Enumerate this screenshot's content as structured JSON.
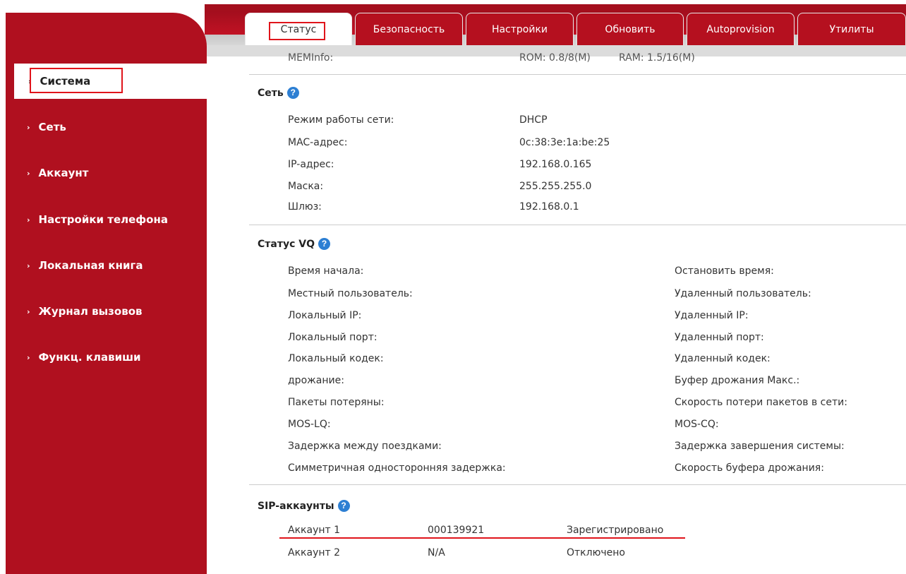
{
  "tabs": [
    {
      "label": "Статус",
      "active": true
    },
    {
      "label": "Безопасность"
    },
    {
      "label": "Настройки"
    },
    {
      "label": "Обновить"
    },
    {
      "label": "Autoprovision"
    },
    {
      "label": "Утилиты"
    }
  ],
  "sidebar": {
    "items": [
      {
        "label": "Система",
        "active": true
      },
      {
        "label": "Сеть"
      },
      {
        "label": "Аккаунт"
      },
      {
        "label": "Настройки телефона"
      },
      {
        "label": "Локальная книга"
      },
      {
        "label": "Журнал вызовов"
      },
      {
        "label": "Функц. клавиши"
      }
    ]
  },
  "meminfo": {
    "label": "MEMInfo:",
    "rom": "ROM: 0.8/8(M)",
    "ram": "RAM: 1.5/16(M)"
  },
  "network": {
    "title": "Сеть",
    "rows": [
      {
        "label": "Режим работы сети:",
        "value": "DHCP"
      },
      {
        "label": "MAC-адрес:",
        "value": "0c:38:3e:1a:be:25"
      },
      {
        "label": "IP-адрес:",
        "value": "192.168.0.165"
      },
      {
        "label": "Маска:",
        "value": "255.255.255.0"
      },
      {
        "label": "Шлюз:",
        "value": "192.168.0.1"
      }
    ]
  },
  "vq": {
    "title": "Статус VQ",
    "left": [
      "Время начала:",
      "Местный пользователь:",
      "Локальный IP:",
      "Локальный порт:",
      "Локальный кодек:",
      "дрожание:",
      "Пакеты потеряны:",
      "MOS-LQ:",
      "Задержка между поездками:",
      "Симметричная односторонняя задержка:"
    ],
    "right": [
      "Остановить время:",
      "Удаленный пользователь:",
      "Удаленный IP:",
      "Удаленный порт:",
      "Удаленный кодек:",
      "Буфер дрожания Макс.:",
      "Скорость потери пакетов в сети:",
      "MOS-CQ:",
      "Задержка завершения системы:",
      "Скорость буфера дрожания:"
    ]
  },
  "sip": {
    "title": "SIP-аккаунты",
    "rows": [
      {
        "account": "Аккаунт 1",
        "number": "000139921",
        "status": "Зарегистрировано"
      },
      {
        "account": "Аккаунт 2",
        "number": "N/A",
        "status": "Отключено"
      }
    ]
  },
  "colors": {
    "brand_red": "#b0101f",
    "highlight": "#e0141b",
    "help_blue": "#2d7fd3"
  },
  "icons": {
    "help": "?",
    "arrow": "›"
  }
}
